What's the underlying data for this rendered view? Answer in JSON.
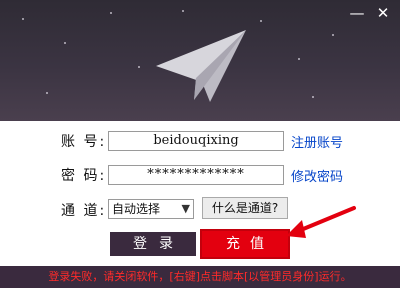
{
  "header": {
    "minimize_glyph": "—",
    "close_glyph": "✕",
    "icon": "paper-plane-icon"
  },
  "form": {
    "account_label": "账  号:",
    "account_value": "beidouqixing",
    "register_link": "注册账号",
    "password_label": "密  码:",
    "password_value": "*************",
    "change_password_link": "修改密码",
    "channel_label": "通  道:",
    "channel_value": "自动选择",
    "channel_help_button": "什么是通道?",
    "login_button": "登录",
    "recharge_button": "充值"
  },
  "status": {
    "message": "登录失败，请关闭软件，[右键]点击脚本[以管理员身份]运行。"
  },
  "colors": {
    "header_bg": "#2f2b35",
    "status_bg": "#3a2a3e",
    "error_text": "#ff2a2a",
    "recharge_bg": "#e3000f",
    "link": "#0645c9"
  }
}
